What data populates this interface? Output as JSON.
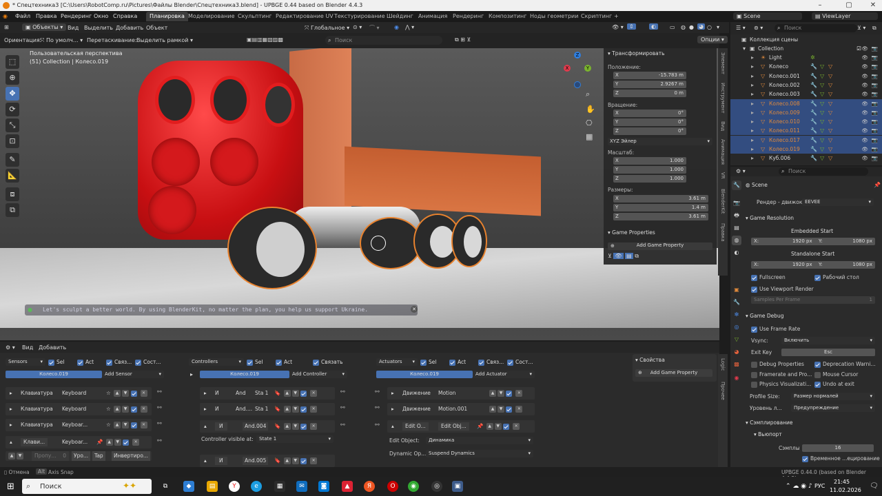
{
  "window": {
    "title": "* Спецтехника3 [C:\\Users\\RobotComp.ru\\Pictures\\Файлы Blender\\Спецтехника3.blend] - UPBGE 0.44 based on Blender 4.4.3",
    "minimize": "–",
    "maximize": "▢",
    "close": "✕"
  },
  "menu": {
    "items": [
      "Файл",
      "Правка",
      "Рендеринг",
      "Окно",
      "Справка"
    ],
    "workspaces": [
      "Планировка",
      "Моделирование",
      "Скульптинг",
      "Редактирование UV",
      "Текстурирование",
      "Шейдинг",
      "Анимация",
      "Рендеринг",
      "Композитинг",
      "Ноды геометрии",
      "Скриптинг"
    ],
    "add_ws": "+",
    "scene": "Scene",
    "view_layer": "ViewLayer"
  },
  "vp_header": {
    "mode": "Объекты",
    "view": "Вид",
    "select": "Выделить",
    "add": "Добавить",
    "object": "Объект",
    "orient": "Глобальное",
    "orientation_label": "Ориентация:",
    "orientation_value": "По умолч...",
    "drag_label": "Перетаскивание:",
    "drag_value": "Выделить рамкой",
    "search_placeholder": "Поиск",
    "options": "Опции"
  },
  "viewport": {
    "perspective": "Пользовательская перспектива",
    "collection_info": "(51) Collection | Колесо.019",
    "banner": "Let's sculpt a better world. By using BlenderKit, no matter the plan, you help us support Ukraine.",
    "gizmo": {
      "x": "X",
      "y": "Y",
      "z": "Z"
    }
  },
  "npanel": {
    "transform": "Трансформировать",
    "location": "Положение:",
    "loc": [
      [
        "X",
        "-15.783 m"
      ],
      [
        "Y",
        "2.9267 m"
      ],
      [
        "Z",
        "0 m"
      ]
    ],
    "rotation": "Вращение:",
    "rot": [
      [
        "X",
        "0°"
      ],
      [
        "Y",
        "0°"
      ],
      [
        "Z",
        "0°"
      ]
    ],
    "rot_mode": "XYZ Эйлер",
    "scale": "Масштаб:",
    "scl": [
      [
        "X",
        "1.000"
      ],
      [
        "Y",
        "1.000"
      ],
      [
        "Z",
        "1.000"
      ]
    ],
    "dimensions": "Размеры:",
    "dim": [
      [
        "X",
        "3.61 m"
      ],
      [
        "Y",
        "1.4 m"
      ],
      [
        "Z",
        "3.61 m"
      ]
    ],
    "game_props": "Game Properties",
    "add_game_prop": "Add Game Property",
    "tabs": [
      "Элемент",
      "Инструмент",
      "Вид",
      "Анимация",
      "VR",
      "BlenderKit",
      "Правка"
    ]
  },
  "outliner": {
    "search_placeholder": "Поиск",
    "root": "Коллекция сцены",
    "collection": "Collection",
    "items": [
      {
        "name": "Light",
        "sel": false
      },
      {
        "name": "Колесо",
        "sel": false
      },
      {
        "name": "Колесо.001",
        "sel": false
      },
      {
        "name": "Колесо.002",
        "sel": false
      },
      {
        "name": "Колесо.003",
        "sel": false
      },
      {
        "name": "Колесо.008",
        "sel": true
      },
      {
        "name": "Колесо.009",
        "sel": true
      },
      {
        "name": "Колесо.010",
        "sel": true
      },
      {
        "name": "Колесо.011",
        "sel": true
      },
      {
        "name": "Колесо.017",
        "sel": true
      },
      {
        "name": "Колесо.019",
        "sel": true
      },
      {
        "name": "Куб.006",
        "sel": false
      }
    ]
  },
  "properties": {
    "search_placeholder": "Поиск",
    "scene": "Scene",
    "engine_label": "Рендер - движок",
    "engine": "EEVEE",
    "game_resolution": "Game Resolution",
    "embedded_start": "Embedded Start",
    "standalone_start": "Standalone Start",
    "x_label": "X:",
    "y_label": "Y:",
    "res_x": "1920 px",
    "res_y": "1080 px",
    "fullscreen": "Fullscreen",
    "desktop": "Рабочий стол",
    "use_viewport_render": "Use Viewport Render",
    "samples_per_frame": "Samples Per Frame",
    "samples_per_frame_val": "1",
    "game_debug": "Game Debug",
    "use_frame_rate": "Use Frame Rate",
    "vsync_label": "Vsync:",
    "vsync": "Включить",
    "exit_key_label": "Exit Key",
    "exit_key": "Esc",
    "debug_props": "Debug Properties",
    "deprecation": "Deprecation Warni...",
    "framerate": "Framerate and Pro...",
    "mouse_cursor": "Mouse Cursor",
    "physics_vis": "Physics Visualizati...",
    "undo_exit": "Undo at exit",
    "profile_label": "Profile Size:",
    "profile": "Размер нормалей",
    "level_label": "Уровень л...",
    "level": "Предупреждение",
    "sampling": "Сэмплирование",
    "viewport_sub": "Вьюпорт",
    "samples_label": "Сэмплы",
    "samples": "16",
    "temporal": "Временное ...ецирование"
  },
  "logic": {
    "view": "Вид",
    "add": "Добавить",
    "sensors": "Sensors",
    "controllers": "Controllers",
    "actuators": "Actuators",
    "sel": "Sel",
    "act": "Act",
    "link": "Связ...",
    "link_full": "Связать",
    "state": "Сост...",
    "object": "Колесо.019",
    "add_sensor": "Add Sensor",
    "add_controller": "Add Controller",
    "add_actuator": "Add Actuator",
    "sensor_rows": [
      [
        "Клавиатура",
        "Keyboard"
      ],
      [
        "Клавиатура",
        "Keyboard"
      ],
      [
        "Клавиатура",
        "Keyboar..."
      ],
      [
        "Клави...",
        "Keyboar..."
      ]
    ],
    "sensor_extra": [
      "Пропу...",
      "0",
      "Уро...",
      "Tap",
      "Инвертиро..."
    ],
    "ctrl_rows": [
      [
        "И",
        "And",
        "Sta 1"
      ],
      [
        "И",
        "And....",
        "Sta 1"
      ],
      [
        "И",
        "And.004",
        ""
      ],
      [
        "И",
        "And.005",
        ""
      ]
    ],
    "ctrl_visible_label": "Controller visible at:",
    "ctrl_visible": "State 1",
    "act_rows": [
      [
        "Движение",
        "Motion"
      ],
      [
        "Движение",
        "Motion.001"
      ],
      [
        "Edit O...",
        "Edit Obj..."
      ]
    ],
    "edit_object_label": "Edit Object:",
    "edit_object": "Динамика",
    "dyn_op_label": "Dynamic Op...",
    "dyn_op": "Suspend Dynamics",
    "props_title": "Свойства",
    "add_game_prop": "Add Game Property",
    "side_tabs": [
      "Logic",
      "Прочее"
    ]
  },
  "status": {
    "left": "Отмена",
    "key": "Alt",
    "snap": "Axis Snap",
    "version": "UPBGE 0.44.0 (based on Blender 4.4.3)"
  },
  "taskbar": {
    "search": "Поиск",
    "lang": "РУС",
    "time": "21:45",
    "date": "11.02.2026"
  }
}
